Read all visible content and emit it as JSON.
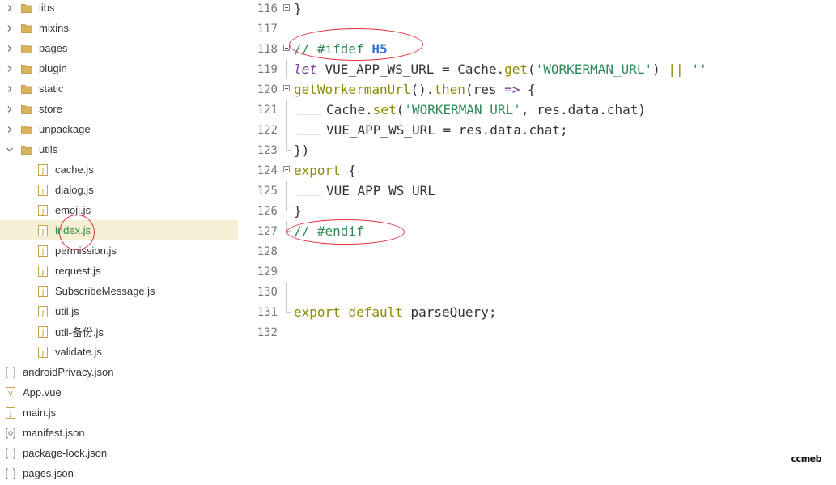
{
  "explorer": {
    "items": [
      {
        "label": "libs",
        "type": "folder",
        "expanded": false,
        "level": 0
      },
      {
        "label": "mixins",
        "type": "folder",
        "expanded": false,
        "level": 0
      },
      {
        "label": "pages",
        "type": "folder",
        "expanded": false,
        "level": 0
      },
      {
        "label": "plugin",
        "type": "folder",
        "expanded": false,
        "level": 0
      },
      {
        "label": "static",
        "type": "folder",
        "expanded": false,
        "level": 0
      },
      {
        "label": "store",
        "type": "folder",
        "expanded": false,
        "level": 0
      },
      {
        "label": "unpackage",
        "type": "folder",
        "expanded": false,
        "level": 0
      },
      {
        "label": "utils",
        "type": "folder",
        "expanded": true,
        "level": 0
      },
      {
        "label": "cache.js",
        "type": "js",
        "level": 1
      },
      {
        "label": "dialog.js",
        "type": "js",
        "level": 1
      },
      {
        "label": "emoji.js",
        "type": "js",
        "level": 1
      },
      {
        "label": "index.js",
        "type": "js",
        "level": 1,
        "selected": true
      },
      {
        "label": "permission.js",
        "type": "js",
        "level": 1
      },
      {
        "label": "request.js",
        "type": "js",
        "level": 1
      },
      {
        "label": "SubscribeMessage.js",
        "type": "js",
        "level": 1
      },
      {
        "label": "util.js",
        "type": "js",
        "level": 1
      },
      {
        "label": "util-备份.js",
        "type": "js",
        "level": 1
      },
      {
        "label": "validate.js",
        "type": "js",
        "level": 1
      },
      {
        "label": "androidPrivacy.json",
        "type": "json",
        "level": 0
      },
      {
        "label": "App.vue",
        "type": "vue",
        "level": 0
      },
      {
        "label": "main.js",
        "type": "js",
        "level": 0
      },
      {
        "label": "manifest.json",
        "type": "manifest",
        "level": 0
      },
      {
        "label": "package-lock.json",
        "type": "json",
        "level": 0
      },
      {
        "label": "pages.json",
        "type": "json",
        "level": 0
      }
    ]
  },
  "editor": {
    "lines": [
      "116",
      "117",
      "118",
      "119",
      "120",
      "121",
      "122",
      "123",
      "124",
      "125",
      "126",
      "127",
      "128",
      "129",
      "130",
      "131",
      "132"
    ],
    "code": {
      "l116_brace": "}",
      "l118_comment": "// #ifdef ",
      "l118_h5": "H5",
      "l119_let": "let",
      "l119_var": " VUE_APP_WS_URL = Cache.",
      "l119_get": "get",
      "l119_open": "(",
      "l119_str1": "'WORKERMAN_URL'",
      "l119_close": ") ",
      "l119_or": "||",
      "l119_sp": " ",
      "l119_str2": "''",
      "l120_fn": "getWorkermanUrl",
      "l120_mid": "().",
      "l120_then": "then",
      "l120_args": "(res ",
      "l120_arrow": "=>",
      "l120_end": " {",
      "l121_a": "Cache.",
      "l121_set": "set",
      "l121_open": "(",
      "l121_str": "'WORKERMAN_URL'",
      "l121_rest": ", res.data.chat)",
      "l122_text": "VUE_APP_WS_URL = res.data.chat;",
      "l123_text": "})",
      "l124_kw": "export",
      "l124_rest": " {",
      "l125_text": "VUE_APP_WS_URL",
      "l126_text": "}",
      "l127_comment": "// #endif",
      "l131_export": "export",
      "l131_default": " default",
      "l131_rest": " parseQuery;"
    }
  },
  "watermark": "ccmeb",
  "colors": {
    "selected_bg": "#f5efd6",
    "folder": "#d9b25e",
    "annotation": "#e0303a",
    "keyword": "#8b8b00",
    "string": "#2e8b57",
    "comment": "#2e8b57",
    "macro": "#2f6fd6"
  }
}
